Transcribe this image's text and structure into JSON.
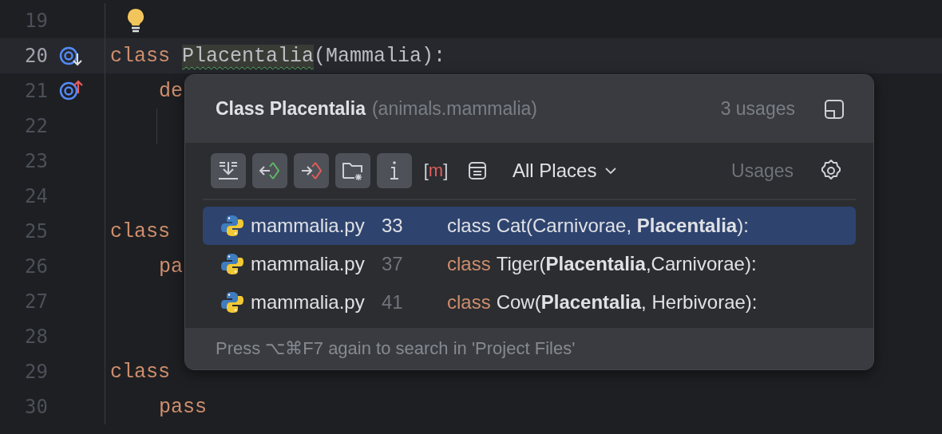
{
  "editor": {
    "lines": [
      {
        "number": "19",
        "current": false,
        "bulb": true
      },
      {
        "number": "20",
        "current": true,
        "bulb": false,
        "marker": {
          "kind": "implemented"
        },
        "tokens": [
          {
            "kind": "keyword",
            "text": "class "
          },
          {
            "kind": "warn",
            "text": "Placentalia"
          },
          {
            "kind": "plain",
            "text": "(Mammalia):"
          }
        ]
      },
      {
        "number": "21",
        "current": false,
        "bulb": false,
        "marker": {
          "kind": "overriding"
        },
        "indent": true,
        "tokens": [
          {
            "kind": "keyword",
            "text": "de"
          }
        ]
      },
      {
        "number": "22",
        "current": false,
        "bulb": false,
        "guide": true
      },
      {
        "number": "23",
        "current": false,
        "bulb": false
      },
      {
        "number": "24",
        "current": false,
        "bulb": false
      },
      {
        "number": "25",
        "current": false,
        "bulb": false,
        "tokens": [
          {
            "kind": "keyword",
            "text": "class"
          }
        ]
      },
      {
        "number": "26",
        "current": false,
        "bulb": false,
        "indent": true,
        "tokens": [
          {
            "kind": "keyword",
            "text": "pa"
          }
        ]
      },
      {
        "number": "27",
        "current": false,
        "bulb": false
      },
      {
        "number": "28",
        "current": false,
        "bulb": false
      },
      {
        "number": "29",
        "current": false,
        "bulb": false,
        "tokens": [
          {
            "kind": "keyword",
            "text": "class"
          }
        ]
      },
      {
        "number": "30",
        "current": false,
        "bulb": false,
        "indent": true,
        "tokens": [
          {
            "kind": "keyword",
            "text": "pass"
          }
        ]
      }
    ]
  },
  "popup": {
    "title": "Class Placentalia",
    "context": "(animals.mammalia)",
    "count": "3 usages",
    "tools": [
      {
        "kind": "merge",
        "selected": true
      },
      {
        "kind": "read",
        "selected": true
      },
      {
        "kind": "write",
        "selected": true
      },
      {
        "kind": "folder",
        "selected": true
      },
      {
        "kind": "info",
        "selected": true
      },
      {
        "kind": "text",
        "label": "[m]",
        "selected": false
      },
      {
        "kind": "list",
        "selected": false
      }
    ],
    "scope": "All Places",
    "scope_hint": "Usages",
    "rows": [
      {
        "file": "mammalia.py",
        "line": "33",
        "keyword": "class",
        "code": "Cat(Carnivorae, **Placentalia**):",
        "selected": true
      },
      {
        "file": "mammalia.py",
        "line": "37",
        "keyword": "class",
        "code": "Tiger(**Placentalia**,Carnivorae):",
        "selected": false
      },
      {
        "file": "mammalia.py",
        "line": "41",
        "keyword": "class",
        "code": "Cow(**Placentalia**, Herbivorae):",
        "selected": false
      }
    ],
    "footer": "Press ⌥⌘F7 again to search in 'Project Files'"
  }
}
